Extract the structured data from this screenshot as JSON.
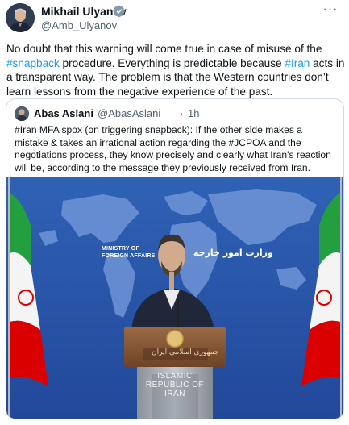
{
  "author": {
    "name": "Mikhail Ulyanov",
    "handle": "@Amb_Ulyanov",
    "verified": true,
    "more_icon": "···"
  },
  "tweet": {
    "text_1": "No doubt that this warning will come true in case of misuse of the ",
    "link_snapback": "#snapback",
    "text_2": " procedure. Everything is predictable because ",
    "link_iran": "#Iran",
    "text_3": " acts in a transparent way. The problem is that the Western countries don’t learn lessons from the negative experience of the past."
  },
  "quoted": {
    "name": "Abas Aslani",
    "handle": "@AbasAslani",
    "separator": "·",
    "time": "1h",
    "text": "#Iran MFA spox (on triggering snapback): If the other side makes a mistake & takes an irrational action regarding the #JCPOA and the negotiations process, they know precisely and clearly what Iran's reaction will be, according to the message they previously received from Iran."
  },
  "image": {
    "backdrop_caption_en_1": "MINISTRY OF",
    "backdrop_caption_en_2": "FOREIGN AFFAIRS",
    "backdrop_caption_fa": "وزارت امور خارجه",
    "plaque_fa": "جمهوری اسلامی ایران",
    "podium_en_1": "ISLAMIC",
    "podium_en_2": "REPUBLIC OF",
    "podium_en_3": "IRAN",
    "colors": {
      "backdrop": "#2a58a8",
      "map": "#6d93d4",
      "flag_green": "#239f40",
      "flag_red": "#da0000",
      "podium_wood": "#8a5a3a"
    }
  }
}
